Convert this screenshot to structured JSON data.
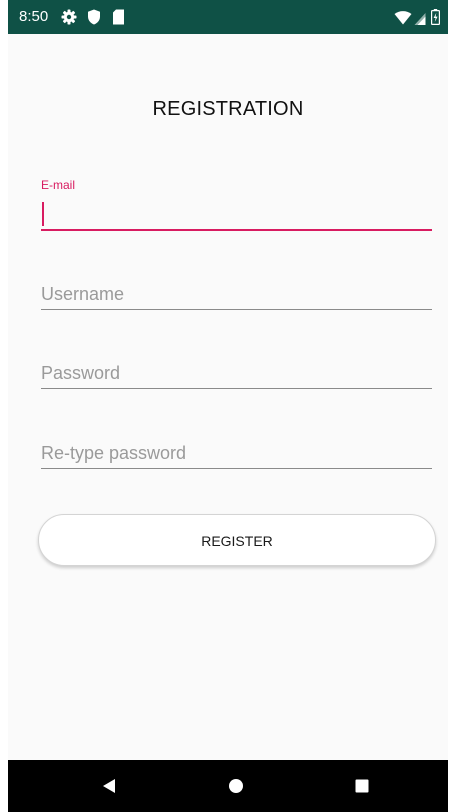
{
  "status_bar": {
    "time": "8:50",
    "icons": [
      "gear-icon",
      "shield-icon",
      "sd-card-icon",
      "wifi-icon",
      "signal-icon",
      "battery-icon"
    ],
    "background": "#0f5146"
  },
  "screen": {
    "title": "REGISTRATION",
    "accent_color": "#d81b60"
  },
  "form": {
    "email": {
      "floating_label": "E-mail",
      "value": ""
    },
    "username": {
      "placeholder": "Username",
      "value": ""
    },
    "password": {
      "placeholder": "Password",
      "value": ""
    },
    "retype_password": {
      "placeholder": "Re-type password",
      "value": ""
    },
    "register_label": "REGISTER"
  },
  "nav_bar": {
    "buttons": [
      "back-icon",
      "home-icon",
      "recents-icon"
    ]
  }
}
